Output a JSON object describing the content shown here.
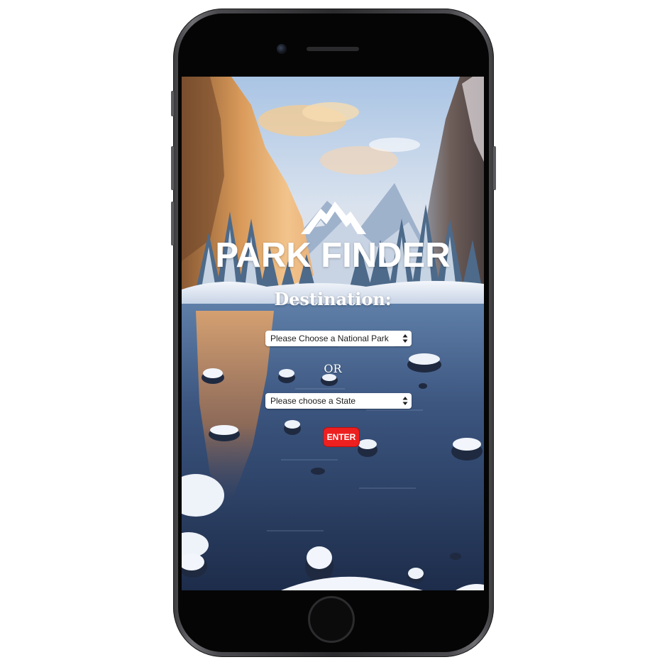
{
  "app": {
    "title": "PARK FINDER",
    "destination_label": "Destination:",
    "park_select": {
      "selected": "Please Choose a National Park"
    },
    "or_label": "OR",
    "state_select": {
      "selected": "Please choose a State"
    },
    "enter_label": "ENTER"
  },
  "colors": {
    "enter_button": "#ee1f1f",
    "title_text": "#ffffff",
    "select_background": "#ffffff",
    "phone_body": "#2b2b2e"
  },
  "icons": {
    "logo": "mountain-logo-icon",
    "select_arrows": "updown-arrows-icon"
  }
}
